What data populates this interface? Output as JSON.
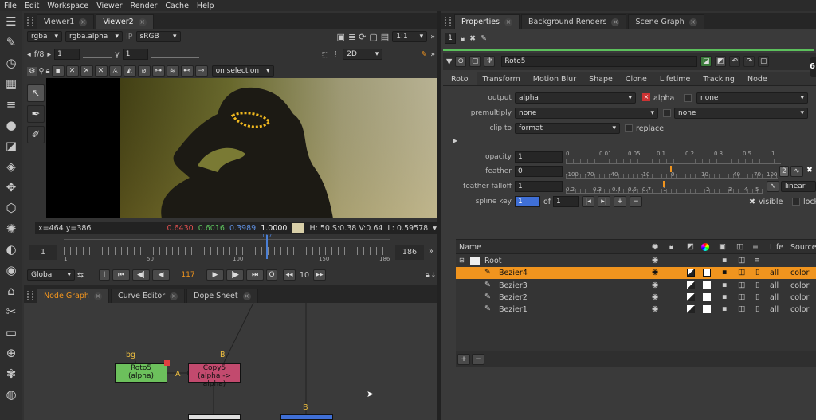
{
  "menu": [
    "File",
    "Edit",
    "Workspace",
    "Viewer",
    "Render",
    "Cache",
    "Help"
  ],
  "viewer_tabs": [
    "Viewer1",
    "Viewer2"
  ],
  "viewer": {
    "channels": "rgba",
    "layer": "rgba.alpha",
    "ip": "IP",
    "colorspace": "sRGB",
    "fstop": "f/8",
    "gain": "1",
    "gamma_label": "γ",
    "gamma": "1",
    "view_mode": "2D",
    "zoom": "1:1",
    "selection_mode": "on selection",
    "status": {
      "coords": "x=464 y=386",
      "r": "0.6430",
      "g": "0.6016",
      "b": "0.3989",
      "a": "1.0000",
      "hsv": "H: 50 S:0.38 V:0.64",
      "lum": "L: 0.59578"
    },
    "timeline": {
      "start": "1",
      "end": "186",
      "marker": "117",
      "ticks": [
        "1",
        "50",
        "100",
        "150",
        "186"
      ]
    },
    "playback": {
      "scope": "Global",
      "frame": "117",
      "step": "10",
      "i": "I",
      "o": "O"
    }
  },
  "bottom_tabs": [
    "Node Graph",
    "Curve Editor",
    "Dope Sheet"
  ],
  "nodes": {
    "roto": "Roto5",
    "roto_sub": "(alpha)",
    "copy": "Copy5",
    "copy_sub": "(alpha -> alpha)",
    "bg": "bg",
    "b1": "B",
    "b2": "B",
    "a": "A"
  },
  "right_tabs": [
    "Properties",
    "Background Renders",
    "Scene Graph"
  ],
  "properties": {
    "count": "1",
    "node_name": "Roto5",
    "subtabs": [
      "Roto",
      "Transform",
      "Motion Blur",
      "Shape",
      "Clone",
      "Lifetime",
      "Tracking",
      "Node"
    ],
    "output_label": "output",
    "output": "alpha",
    "output_check": "alpha",
    "output_none": "none",
    "premult_label": "premultiply",
    "premult": "none",
    "premult_none": "none",
    "clip_label": "clip to",
    "clip": "format",
    "replace": "replace",
    "opacity_label": "opacity",
    "opacity": "1",
    "feather_label": "feather",
    "feather": "0",
    "falloff_label": "feather falloff",
    "falloff": "1",
    "falloff_type": "linear",
    "spline_label": "spline key",
    "spline": "1",
    "of": "of",
    "spline_total": "1",
    "visible": "visible",
    "locked": "locked",
    "opacity_ticks": [
      "0",
      "0.01",
      "0.05",
      "0.1",
      "0.2",
      "0.3",
      "0.5",
      "1"
    ],
    "feather_ticks": [
      "-100",
      "-70",
      "-40",
      "-10",
      "0",
      "10",
      "40",
      "70",
      "100"
    ],
    "falloff_ticks": [
      "0.2",
      "0.3",
      "0.4",
      "0.5",
      "0.7",
      "1",
      "2",
      "3",
      "4",
      "5"
    ],
    "feather_anim": "2"
  },
  "layers": {
    "columns": [
      "Name",
      "Life",
      "Source"
    ],
    "rows": [
      {
        "name": "Root",
        "life": "",
        "source": ""
      },
      {
        "name": "Bezier4",
        "life": "all",
        "source": "color"
      },
      {
        "name": "Bezier3",
        "life": "all",
        "source": "color"
      },
      {
        "name": "Bezier2",
        "life": "all",
        "source": "color"
      },
      {
        "name": "Bezier1",
        "life": "all",
        "source": "color"
      }
    ]
  },
  "edge_badge": "6",
  "colors": {
    "accent": "#f0941e",
    "roto_node": "#6cc05c",
    "copy_node": "#c24a6e"
  }
}
